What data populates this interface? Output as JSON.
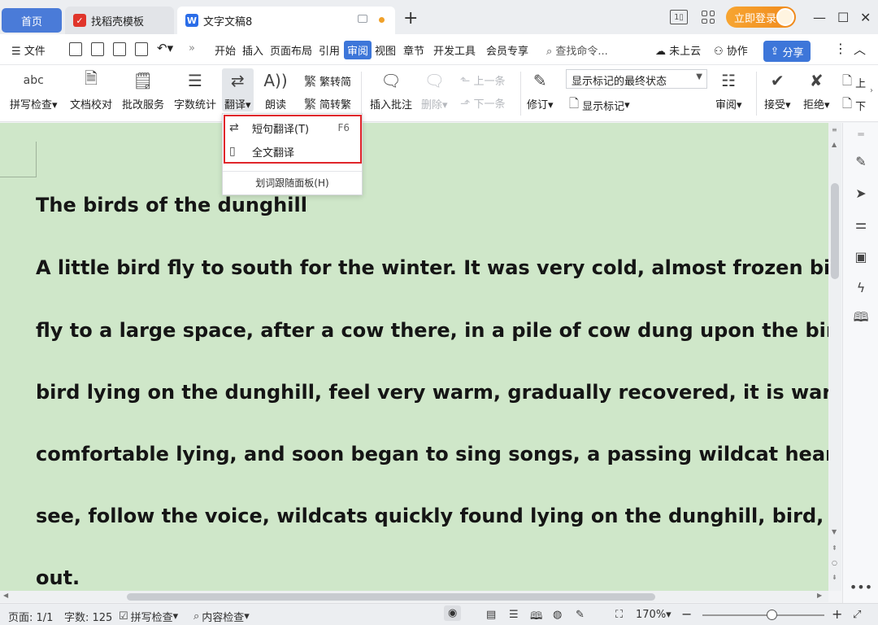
{
  "tabs": {
    "home": "首页",
    "docer": "找稻壳模板",
    "doc": "文字文稿8",
    "add": "+"
  },
  "titlebar": {
    "login": "立即登录"
  },
  "menu": {
    "file": "文件",
    "items": [
      "开始",
      "插入",
      "页面布局",
      "引用",
      "审阅",
      "视图",
      "章节",
      "开发工具",
      "会员专享"
    ],
    "active": "审阅",
    "search_placeholder": "查找命令...",
    "cloud": "未上云",
    "collab": "协作",
    "share": "分享"
  },
  "ribbon": {
    "spell": "拼写检查",
    "proof": "文档校对",
    "approve": "批改服务",
    "wordcount": "字数统计",
    "translate": "翻译",
    "read": "朗读",
    "trad_to_simp": "繁转简",
    "simp_to_trad": "简转繁",
    "insert_comment": "插入批注",
    "delete": "删除",
    "prev": "上一条",
    "next": "下一条",
    "revise": "修订",
    "markup_state": "显示标记的最终状态",
    "show_markup": "显示标记",
    "review": "审阅",
    "accept": "接受",
    "reject": "拒绝",
    "right_cut_1": "上",
    "right_cut_2": "下"
  },
  "translate_menu": {
    "short": "短句翻译(T)",
    "short_key": "F6",
    "full": "全文翻译",
    "panel": "划词跟随面板(H)"
  },
  "document": {
    "title": "The birds of the dunghill",
    "lines": [
      "A little bird fly to south for the winter. It was very cold, almost frozen bird. Her",
      "fly to a large space, after a cow there, in a pile of cow dung upon the bird, froz",
      "bird lying on the dunghill, feel very warm, gradually recovered, it is warm a",
      "comfortable lying, and soon began to sing songs, a passing wildcat hear voic",
      "see, follow the voice, wildcats quickly found lying on the dunghill, bird, pul",
      "out."
    ]
  },
  "status": {
    "page": "页面: 1/1",
    "words": "字数: 125",
    "spell": "拼写检查",
    "content_check": "内容检查",
    "zoom": "170%"
  },
  "colors": {
    "accent": "#3d76d9",
    "doc_bg": "#cfe7c9",
    "highlight": "#e0262b",
    "login": "#f39a25"
  }
}
